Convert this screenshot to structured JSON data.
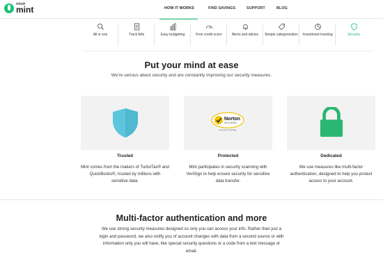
{
  "brand": {
    "intuit": "intuit",
    "name": "mint",
    "color": "#1dbf73"
  },
  "nav": {
    "links": [
      "HOW IT WORKS",
      "FIND SAVINGS",
      "SUPPORT",
      "BLOG"
    ],
    "active": "HOW IT WORKS"
  },
  "features": [
    {
      "label": "All in one",
      "icon": "search-icon"
    },
    {
      "label": "Track bills",
      "icon": "bill-icon"
    },
    {
      "label": "Easy budgeting",
      "icon": "bar-chart-icon"
    },
    {
      "label": "Free credit score",
      "icon": "gauge-icon"
    },
    {
      "label": "Alerts and advice",
      "icon": "bell-icon"
    },
    {
      "label": "Simple categorization",
      "icon": "tag-icon"
    },
    {
      "label": "Investment tracking",
      "icon": "pie-icon"
    },
    {
      "label": "Security",
      "icon": "shield-icon",
      "active": true
    }
  ],
  "hero": {
    "title": "Put your mind at ease",
    "subtitle": "We’re serious about security and are constantly improving our security measures."
  },
  "cards": [
    {
      "title": "Trusted",
      "body": "Mint comes from the makers of TurboTax® and QuickBooks®, trusted by millions with sensitive data.",
      "icon": "shield-icon"
    },
    {
      "title": "Protected",
      "body": "Mint participates in security scanning with VeriSign to help ensure security for sensitive data transfer.",
      "icon": "norton-secured-badge",
      "badge": {
        "name": "Norton",
        "tagline": "SECURED",
        "powered": "powered by VeriSign"
      }
    },
    {
      "title": "Dedicated",
      "body": "We use measures like multi-factor authentication, designed to help you protect access to your account.",
      "icon": "padlock-icon"
    }
  ],
  "mfa": {
    "title": "Multi-factor authentication and more",
    "body": "We use strong security measures designed so only you can access your info. Rather than just a login and password, we also notify you of account changes with data from a second source or with information only you will have, like special security questions or a code from a text message or email."
  }
}
